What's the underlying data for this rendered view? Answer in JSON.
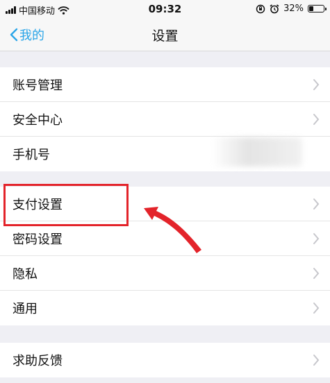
{
  "status_bar": {
    "carrier": "中国移动",
    "time": "09:32",
    "battery": "32%",
    "battery_level": 0.32
  },
  "nav": {
    "back_label": "我的",
    "title": "设置"
  },
  "groups": [
    {
      "items": [
        {
          "label": "账号管理"
        },
        {
          "label": "安全中心"
        },
        {
          "label": "手机号"
        }
      ]
    },
    {
      "items": [
        {
          "label": "支付设置"
        },
        {
          "label": "密码设置"
        },
        {
          "label": "隐私"
        },
        {
          "label": "通用"
        }
      ]
    },
    {
      "items": [
        {
          "label": "求助反馈"
        }
      ]
    }
  ],
  "colors": {
    "accent": "#2aa5e8",
    "annotation": "#e3232a",
    "background": "#efeff4"
  },
  "icons": [
    "wifi-icon",
    "orientation-lock-icon",
    "alarm-icon",
    "chevron-left-icon",
    "chevron-right-icon",
    "annotation-arrow"
  ]
}
